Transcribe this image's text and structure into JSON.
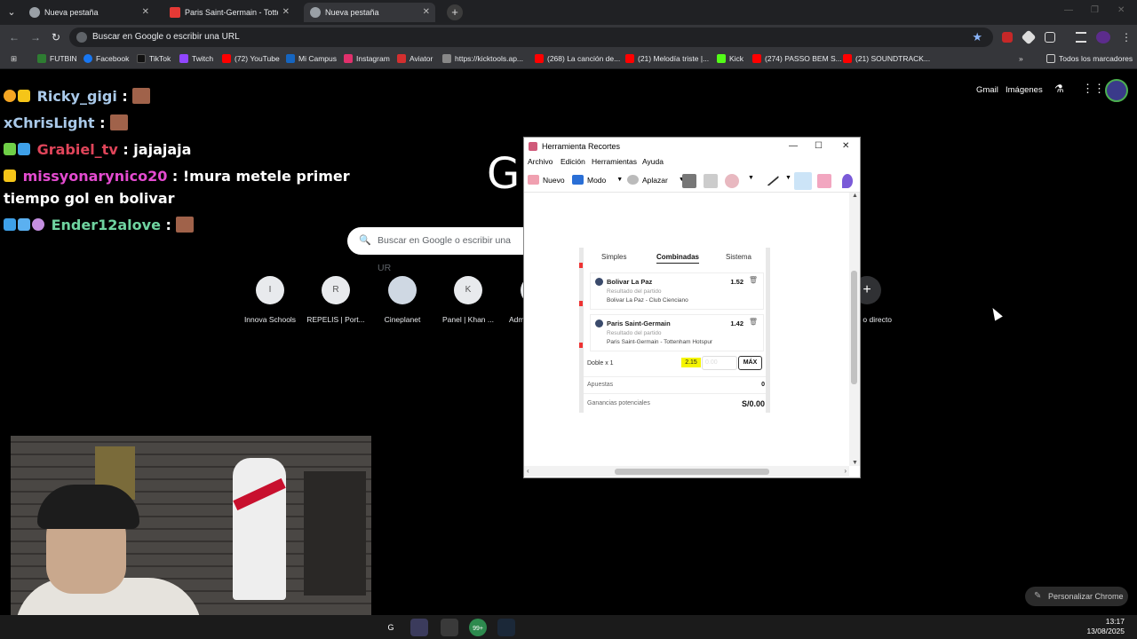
{
  "browser": {
    "tabs": [
      {
        "title": "Nueva pestaña",
        "active": false
      },
      {
        "title": "Paris Saint-Germain - Tottenham",
        "active": false
      },
      {
        "title": "Nueva pestaña",
        "active": true
      }
    ],
    "omnibox_text": "Buscar en Google o escribir una URL",
    "bookmarks": [
      {
        "label": "FUTBIN",
        "color": "#2e7d32"
      },
      {
        "label": "Facebook",
        "color": "#1877f2"
      },
      {
        "label": "TikTok",
        "color": "#111111"
      },
      {
        "label": "Twitch",
        "color": "#9146ff"
      },
      {
        "label": "(72) YouTube",
        "color": "#ff0000"
      },
      {
        "label": "Mi Campus",
        "color": "#1565c0"
      },
      {
        "label": "Instagram",
        "color": "#e1306c"
      },
      {
        "label": "Aviator",
        "color": "#d32f2f"
      },
      {
        "label": "https://kicktools.ap...",
        "color": "#888888"
      },
      {
        "label": "(268) La canción de...",
        "color": "#ff0000"
      },
      {
        "label": "(21) Melodía triste |...",
        "color": "#ff0000"
      },
      {
        "label": "Kick",
        "color": "#53fc18"
      },
      {
        "label": "(274) PASSO BEM S...",
        "color": "#ff0000"
      },
      {
        "label": "(21) SOUNDTRACK...",
        "color": "#ff0000"
      }
    ],
    "all_bookmarks_label": "Todos los marcadores"
  },
  "google": {
    "logo_text": "G",
    "search_placeholder": "Buscar en Google o escribir una UR",
    "top_links": {
      "gmail": "Gmail",
      "images": "Imágenes"
    },
    "shortcuts": [
      {
        "initial": "I",
        "label": "Innova Schools"
      },
      {
        "initial": "R",
        "label": "REPELIS | Port..."
      },
      {
        "initial": "",
        "label": "Cineplanet"
      },
      {
        "initial": "K",
        "label": "Panel | Khan ..."
      },
      {
        "initial": "",
        "label": "Adm"
      },
      {
        "initial": "+",
        "label": "o directo"
      }
    ],
    "customize_label": "Personalizar Chrome"
  },
  "chat": [
    {
      "user": "Ricky_gigi",
      "user_color": "#a9c9e9",
      "message": "",
      "emote": true
    },
    {
      "user": "xChrisLight",
      "user_color": "#a9c9e9",
      "message": "",
      "emote": true
    },
    {
      "user": "Grabiel_tv",
      "user_color": "#e0455a",
      "message": "jajajaja",
      "emote": false
    },
    {
      "user": "missyonarynico20",
      "user_color": "#e44bd0",
      "message": "!mura metele primer tiempo gol en bolivar",
      "emote": false
    },
    {
      "user": "Ender12alove",
      "user_color": "#6fd3a0",
      "message": "",
      "emote": true
    }
  ],
  "snip": {
    "title": "Herramienta Recortes",
    "menu": [
      "Archivo",
      "Edición",
      "Herramientas",
      "Ayuda"
    ],
    "tools": {
      "nuevo": "Nuevo",
      "modo": "Modo",
      "aplazar": "Aplazar"
    }
  },
  "betslip": {
    "tabs": [
      "Simples",
      "Combinadas",
      "Sistema"
    ],
    "active_tab": "Combinadas",
    "bets": [
      {
        "team": "Bolivar La Paz",
        "market": "Resultado del partido",
        "match": "Bolivar La Paz - Club Cienciano",
        "odd": "1.52"
      },
      {
        "team": "Paris Saint-Germain",
        "market": "Resultado del partido",
        "match": "Paris Saint-Germain - Tottenham Hotspur",
        "odd": "1.42"
      }
    ],
    "combo_label": "Doble x 1",
    "combo_odd": "2.15",
    "stake_placeholder": "0.00",
    "max_label": "MÁX",
    "apuestas_label": "Apuestas",
    "apuestas_value": "0",
    "ganancias_label": "Ganancias potenciales",
    "ganancias_value": "S/0.00"
  },
  "taskbar": {
    "time": "13:17",
    "date": "13/08/2025",
    "badge": "99+"
  }
}
